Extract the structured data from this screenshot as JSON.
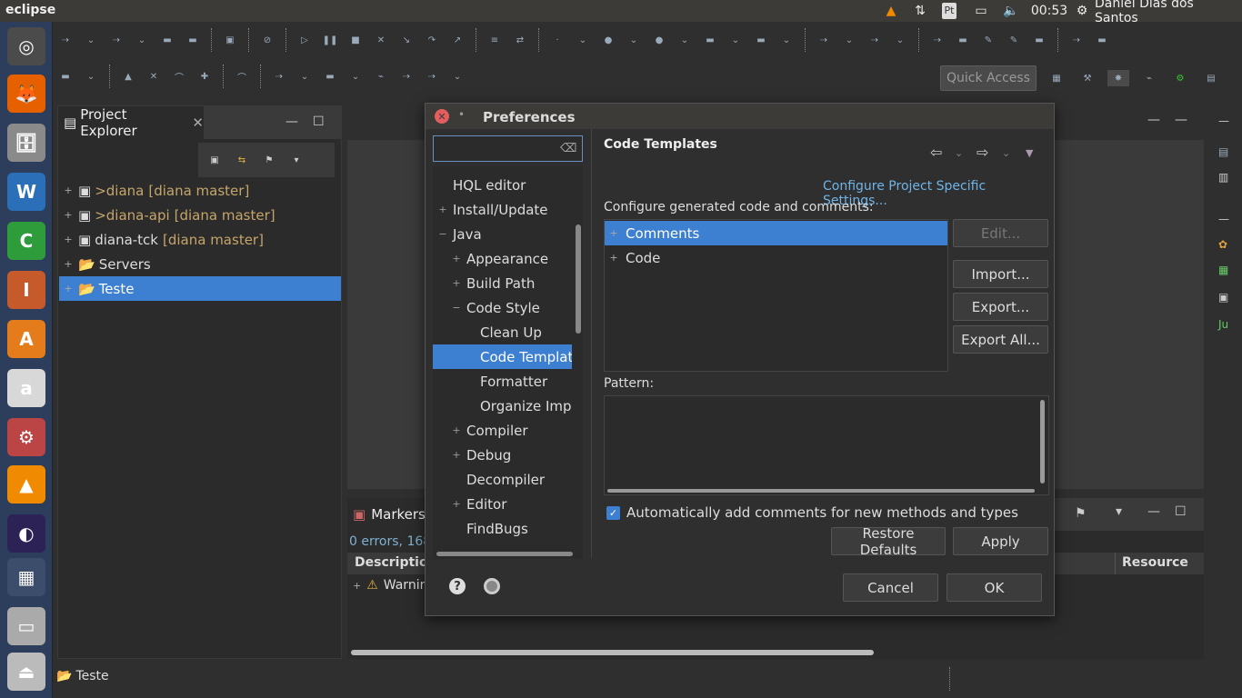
{
  "top_panel": {
    "app_name": "eclipse",
    "keyboard_layout": "Pt",
    "clock": "00:53",
    "user": "Daniel Dias dos Santos"
  },
  "launcher": {
    "items": [
      {
        "name": "ubuntu-dash",
        "glyph": "◎",
        "color": "#4b4b4b"
      },
      {
        "name": "firefox",
        "glyph": "🦊",
        "color": "#e66000"
      },
      {
        "name": "files",
        "glyph": "🗄",
        "color": "#8a8a8a"
      },
      {
        "name": "writer",
        "glyph": "W",
        "color": "#2a6fb8"
      },
      {
        "name": "calc",
        "glyph": "C",
        "color": "#2f9c3c"
      },
      {
        "name": "impress",
        "glyph": "I",
        "color": "#c65a2a"
      },
      {
        "name": "software-center",
        "glyph": "A",
        "color": "#e57c1b"
      },
      {
        "name": "amazon",
        "glyph": "a",
        "color": "#d8d8d8"
      },
      {
        "name": "system-settings",
        "glyph": "⚙",
        "color": "#b44"
      },
      {
        "name": "vlc",
        "glyph": "▲",
        "color": "#f08a00"
      },
      {
        "name": "eclipse",
        "glyph": "◐",
        "color": "#2c2255"
      },
      {
        "name": "workspace",
        "glyph": "▦",
        "color": "#3c4d6b"
      },
      {
        "name": "drive",
        "glyph": "▭",
        "color": "#aaa"
      },
      {
        "name": "usb",
        "glyph": "⏏",
        "color": "#bbb"
      }
    ]
  },
  "quick_access": "Quick Access",
  "project_explorer": {
    "title": "Project Explorer",
    "items": [
      {
        "prefix": "> ",
        "name": "diana",
        "git": "[diana master]",
        "selected": false
      },
      {
        "prefix": "> ",
        "name": "diana-api",
        "git": "[diana master]",
        "selected": false
      },
      {
        "prefix": "",
        "name": "diana-tck",
        "git": "[diana master]",
        "selected": false
      },
      {
        "prefix": "",
        "name": "Servers",
        "git": "",
        "selected": false
      },
      {
        "prefix": "",
        "name": "Teste",
        "git": "",
        "selected": true
      }
    ]
  },
  "markers": {
    "title": "Markers",
    "summary": "0 errors, 168",
    "col_description": "Description",
    "col_resource": "Resource",
    "row_text": "Warnir"
  },
  "status_bar": {
    "text": "Teste"
  },
  "preferences": {
    "title": "Preferences",
    "filter_value": "",
    "tree": [
      {
        "label": "HQL editor",
        "level": 0,
        "expander": "",
        "selected": false
      },
      {
        "label": "Install/Update",
        "level": 0,
        "expander": "+",
        "selected": false
      },
      {
        "label": "Java",
        "level": 0,
        "expander": "−",
        "selected": false
      },
      {
        "label": "Appearance",
        "level": 1,
        "expander": "+",
        "selected": false
      },
      {
        "label": "Build Path",
        "level": 1,
        "expander": "+",
        "selected": false
      },
      {
        "label": "Code Style",
        "level": 1,
        "expander": "−",
        "selected": false
      },
      {
        "label": "Clean Up",
        "level": 2,
        "expander": "",
        "selected": false
      },
      {
        "label": "Code Template",
        "level": 2,
        "expander": "",
        "selected": true
      },
      {
        "label": "Formatter",
        "level": 2,
        "expander": "",
        "selected": false
      },
      {
        "label": "Organize Impo",
        "level": 2,
        "expander": "",
        "selected": false
      },
      {
        "label": "Compiler",
        "level": 1,
        "expander": "+",
        "selected": false
      },
      {
        "label": "Debug",
        "level": 1,
        "expander": "+",
        "selected": false
      },
      {
        "label": "Decompiler",
        "level": 1,
        "expander": "",
        "selected": false
      },
      {
        "label": "Editor",
        "level": 1,
        "expander": "+",
        "selected": false
      },
      {
        "label": "FindBugs",
        "level": 1,
        "expander": "",
        "selected": false
      }
    ],
    "page_title": "Code Templates",
    "project_link": "Configure Project Specific Settings...",
    "description": "Configure generated code and comments:",
    "templates": [
      {
        "label": "Comments",
        "selected": true
      },
      {
        "label": "Code",
        "selected": false
      }
    ],
    "buttons": {
      "edit": "Edit...",
      "import": "Import...",
      "export": "Export...",
      "export_all": "Export All..."
    },
    "pattern_label": "Pattern:",
    "auto_comments_label": "Automatically add comments for new methods and types",
    "auto_comments_checked": true,
    "restore_defaults": "Restore Defaults",
    "apply": "Apply",
    "cancel": "Cancel",
    "ok": "OK"
  }
}
